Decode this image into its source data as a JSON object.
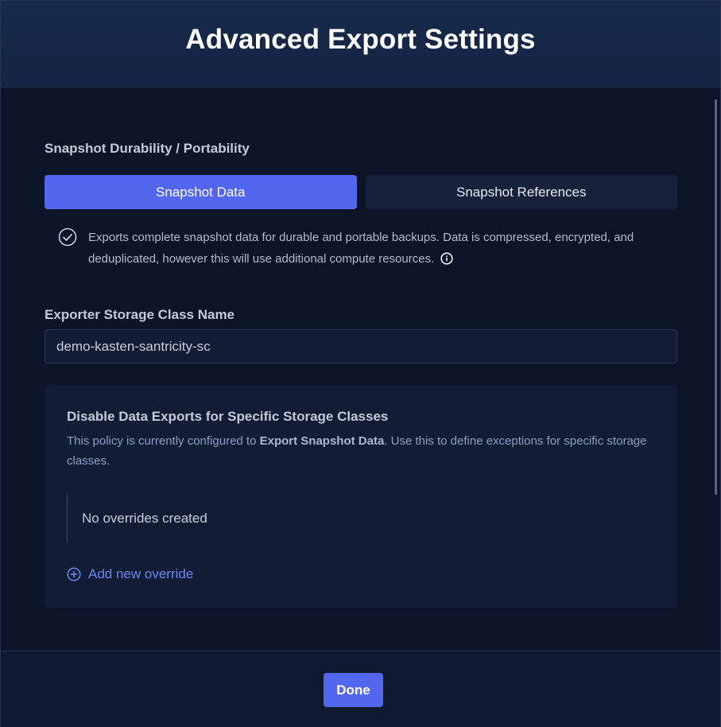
{
  "dialog": {
    "title": "Advanced Export Settings"
  },
  "durability": {
    "label": "Snapshot Durability / Portability",
    "options": [
      {
        "label": "Snapshot Data",
        "selected": true
      },
      {
        "label": "Snapshot References",
        "selected": false
      }
    ],
    "description_icon": "check-circle-icon",
    "description": "Exports complete snapshot data for durable and portable backups. Data is compressed, encrypted, and deduplicated, however this will use additional compute resources.",
    "info_icon": "info-icon"
  },
  "storage_class": {
    "label": "Exporter Storage Class Name",
    "value": "demo-kasten-santricity-sc"
  },
  "overrides": {
    "title": "Disable Data Exports for Specific Storage Classes",
    "desc_prefix": "This policy is currently configured to ",
    "desc_emphasis": "Export Snapshot Data",
    "desc_suffix": ". Use this to define exceptions for specific storage classes.",
    "empty_text": "No overrides created",
    "add_label": "Add new override",
    "add_icon": "plus-circle-icon"
  },
  "footer": {
    "done_label": "Done"
  },
  "colors": {
    "primary": "#5366ee",
    "link": "#6f86f3",
    "background": "#0c1527",
    "header": "#172a4a"
  }
}
